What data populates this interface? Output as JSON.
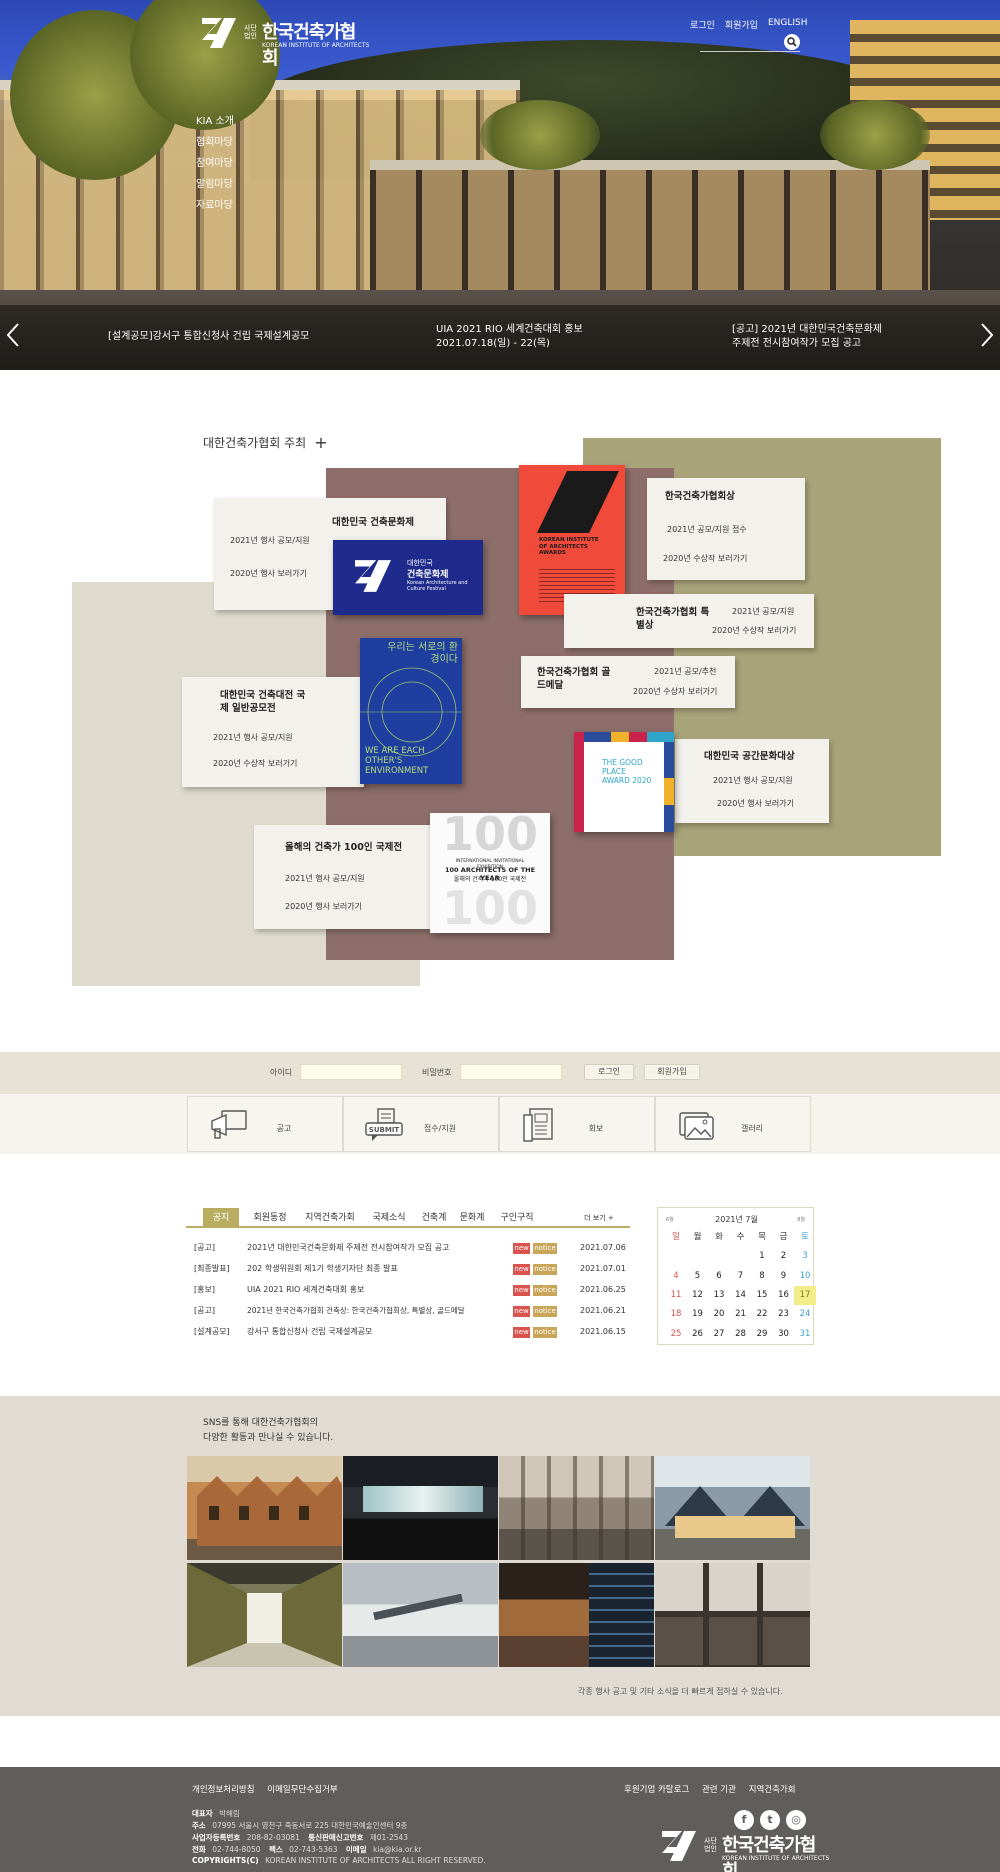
{
  "header": {
    "logo_name": "한국건축가협회",
    "logo_corp": "사단법인",
    "logo_sub": "KOREAN INSTITUTE OF ARCHITECTS",
    "top_links": [
      "로그인",
      "회원가입",
      "ENGLISH"
    ],
    "gnb": [
      "KIA 소개",
      "협회마당",
      "참여마당",
      "알림마당",
      "자료마당"
    ]
  },
  "hero": {
    "captions": [
      {
        "line1": "[설계공모]강서구 통합신청사 건립 국제설계공모",
        "line2": ""
      },
      {
        "line1": "UIA 2021 RIO 세계건축대회 홍보",
        "line2": "2021.07.18(일) - 22(목)"
      },
      {
        "line1": "[공고] 2021년 대한민국건축문화제",
        "line2": "주제전 전시참여작가 모집 공고"
      }
    ]
  },
  "events": {
    "title": "대한건축가협회 주최",
    "plus": "+",
    "cards": [
      {
        "title": "대한민국 건축문화제",
        "l1": "2021년 행사 공모/지원",
        "l2": "2020년 행사 보러가기"
      },
      {
        "title": "한국건축가협회상",
        "l1": "2021년 공모/지원 접수",
        "l2": "2020년 수상작 보러가기"
      },
      {
        "title": "한국건축가협회 특별상",
        "l1": "2021년 공모/지원",
        "l2": "2020년 수상작 보러가기"
      },
      {
        "title": "한국건축가협회 골드메달",
        "l1": "2021년 공모/추천",
        "l2": "2020년 수상자 보러가기"
      },
      {
        "title": "대한민국 건축대전 국제 일반공모전",
        "l1": "2021년 행사 공모/지원",
        "l2": "2020년 수상작 보러가기"
      },
      {
        "title": "대한민국 공간문화대상",
        "l1": "2021년 행사 공모/지원",
        "l2": "2020년 행사 보러가기"
      },
      {
        "title": "올해의 건축가 100인 국제전",
        "l1": "2021년 행사 공모/지원",
        "l2": "2020년 행사 보러가기"
      }
    ],
    "posters": {
      "festival_ko": "대한민국",
      "festival_name": "건축문화제",
      "festival_en": "Korean Architecture and Culture Festival",
      "kia_awards": "KOREAN INSTITUTE OF ARCHITECTS AWARDS",
      "blue_top": "우리는 서로의 환경이다",
      "blue_bottom": "WE ARE EACH OTHER'S ENVIRONMENT",
      "good_place": "THE GOOD PLACE AWARD 2020",
      "arch100_sub": "INTERNATIONAL INVITATIONAL EXHIBITION",
      "arch100_title": "100 ARCHITECTS OF THE YEAR",
      "arch100_ko": "올해의 건축가 100인 국제전",
      "arch100_num": "100"
    }
  },
  "login": {
    "id_label": "아이디",
    "pw_label": "비밀번호",
    "login_btn": "로그인",
    "join_btn": "회원가입"
  },
  "quick": [
    "공고",
    "접수/지원",
    "회보",
    "갤러리"
  ],
  "notice": {
    "tabs": [
      "공지",
      "회원동정",
      "지역건축가회",
      "국제소식",
      "건축계",
      "문화계",
      "구인구직"
    ],
    "more": "더 보기 +",
    "badge_new": "new",
    "badge_notice": "notice",
    "rows": [
      {
        "cat": "[공고]",
        "title": "2021년 대한민국건축문화제 주제전 전시참여작가 모집 공고",
        "date": "2021.07.06"
      },
      {
        "cat": "[최종발표]",
        "title": "202 학생위원회 제1기 학생기자단 최종 발표",
        "date": "2021.07.01"
      },
      {
        "cat": "[홍보]",
        "title": "UIA 2021 RIO 세계건축대회 홍보",
        "date": "2021.06.25"
      },
      {
        "cat": "[공고]",
        "title": "2021년 한국건축가협회 건축상: 한국건축가협회상, 특별상, 골드메달",
        "date": "2021.06.21"
      },
      {
        "cat": "[설계공모]",
        "title": "강서구 통합신청사 건립 국제설계공모",
        "date": "2021.06.15"
      }
    ]
  },
  "calendar": {
    "title": "2021년 7월",
    "prev": "6월",
    "next": "8월",
    "weekdays": [
      "일",
      "월",
      "화",
      "수",
      "목",
      "금",
      "토"
    ],
    "weeks": [
      [
        "",
        "",
        "",
        "",
        "1",
        "2",
        "3"
      ],
      [
        "4",
        "5",
        "6",
        "7",
        "8",
        "9",
        "10"
      ],
      [
        "11",
        "12",
        "13",
        "14",
        "15",
        "16",
        "17"
      ],
      [
        "18",
        "19",
        "20",
        "21",
        "22",
        "23",
        "24"
      ],
      [
        "25",
        "26",
        "27",
        "28",
        "29",
        "30",
        "31"
      ]
    ],
    "highlight": "17",
    "colors": {
      "sun": "#d9534f",
      "sat": "#3aa0d8",
      "accent": "#b9ad62",
      "highlight_bg": "#f2ec8a"
    }
  },
  "sns": {
    "msg_line1": "SNS를 통해 대한건축가협회의",
    "msg_line2": "다양한 활동과 만나실 수 있습니다.",
    "note": "각종 행사 공고 및 기타 소식을 더 빠르게 접하실 수 있습니다."
  },
  "footer": {
    "left_links": [
      "개인정보처리방침",
      "이메일무단수집거부"
    ],
    "right_links": [
      "후원기업 카탈로그",
      "관련 기관",
      "지역건축가회"
    ],
    "rep_label": "대표자",
    "rep": "박해림",
    "addr_label": "주소",
    "addr": "07995 서울시 영천구 죽동서로 225 대한민국예술인센터 9층",
    "biz_label": "사업자등록번호",
    "biz": "208-82-03081",
    "mail_order_label": "통신판매신고번호",
    "mail_order": "제01-2543",
    "tel_label": "전화",
    "tel": "02-744-8050",
    "fax_label": "팩스",
    "fax": "02-743-5363",
    "email_label": "이메일",
    "email": "kia@kia.or.kr",
    "copy_label": "COPYRIGHTS(C)",
    "copy": "KOREAN INSTITUTE OF ARCHITECTS ALL RIGHT RESERVED.",
    "social": [
      "f",
      "t",
      "◎"
    ],
    "logo_name": "한국건축가협회",
    "logo_corp": "사단법인",
    "logo_sub": "KOREAN INSTITUTE OF ARCHITECTS"
  },
  "colors": {
    "olive": "#b9ad62",
    "red_badge": "#d9534f",
    "footer_bg": "#5f5e5c"
  }
}
